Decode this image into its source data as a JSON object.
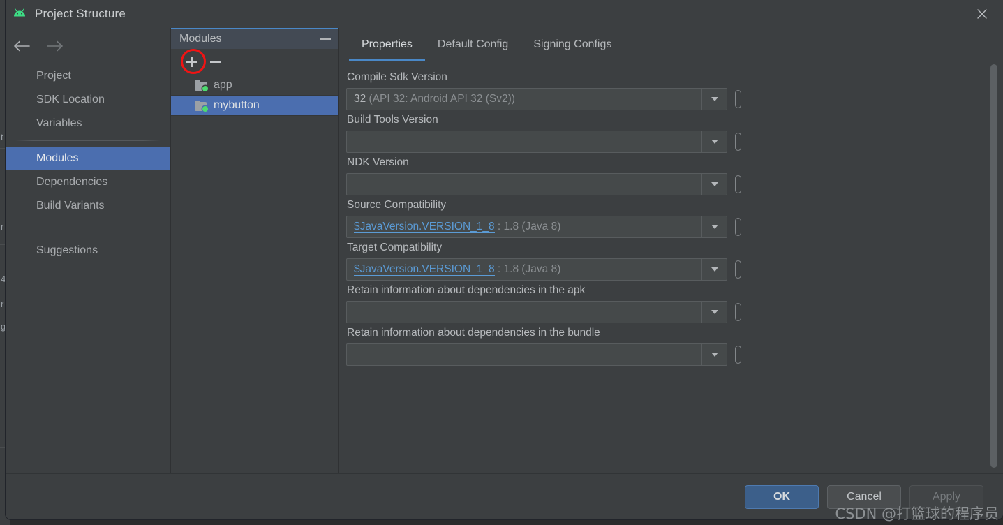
{
  "window": {
    "title": "Project Structure",
    "app_icon": "android-robot-icon",
    "close_icon": "close-icon"
  },
  "navigation": {
    "back_icon": "arrow-left-icon",
    "forward_icon": "arrow-right-icon",
    "items": [
      {
        "label": "Project",
        "selected": false
      },
      {
        "label": "SDK Location",
        "selected": false
      },
      {
        "label": "Variables",
        "selected": false
      },
      {
        "label": "Modules",
        "selected": true
      },
      {
        "label": "Dependencies",
        "selected": false
      },
      {
        "label": "Build Variants",
        "selected": false
      },
      {
        "label": "Suggestions",
        "selected": false
      }
    ]
  },
  "modules_panel": {
    "title": "Modules",
    "minimize_icon": "minimize-icon",
    "toolbar": {
      "add_icon": "plus-icon",
      "remove_icon": "minus-icon",
      "annotation": "red-circle-highlight"
    },
    "items": [
      {
        "label": "app",
        "icon": "module-folder-icon",
        "selected": false
      },
      {
        "label": "mybutton",
        "icon": "module-folder-icon",
        "selected": true
      }
    ]
  },
  "tabs": [
    {
      "label": "Properties",
      "active": true
    },
    {
      "label": "Default Config",
      "active": false
    },
    {
      "label": "Signing Configs",
      "active": false
    }
  ],
  "properties": {
    "fields": [
      {
        "label": "Compile Sdk Version",
        "value_main": "32",
        "value_dim": " (API 32: Android API 32 (Sv2))",
        "is_variable": false
      },
      {
        "label": "Build Tools Version",
        "value_main": "",
        "value_dim": "",
        "is_variable": false
      },
      {
        "label": "NDK Version",
        "value_main": "",
        "value_dim": "",
        "is_variable": false
      },
      {
        "label": "Source Compatibility",
        "value_main": "$JavaVersion.VERSION_1_8",
        "value_dim": " : 1.8 (Java 8)",
        "is_variable": true
      },
      {
        "label": "Target Compatibility",
        "value_main": "$JavaVersion.VERSION_1_8",
        "value_dim": " : 1.8 (Java 8)",
        "is_variable": true
      },
      {
        "label": "Retain information about dependencies in the apk",
        "value_main": "",
        "value_dim": "",
        "is_variable": false
      },
      {
        "label": "Retain information about dependencies in the bundle",
        "value_main": "",
        "value_dim": "",
        "is_variable": false
      }
    ]
  },
  "footer": {
    "ok": "OK",
    "cancel": "Cancel",
    "apply": "Apply"
  },
  "watermark": "CSDN @打篮球的程序员",
  "ide_bleed_chars": [
    "t",
    "r",
    "4",
    "r",
    "g"
  ],
  "colors": {
    "dialog_bg": "#3c3f41",
    "selection_blue": "#4b6eaf",
    "tab_accent": "#4a88c7",
    "android_green": "#3ddc84",
    "annotation_red": "#f01414",
    "primary_button": "#3c5f8a",
    "variable_blue": "#5b9bd5"
  }
}
